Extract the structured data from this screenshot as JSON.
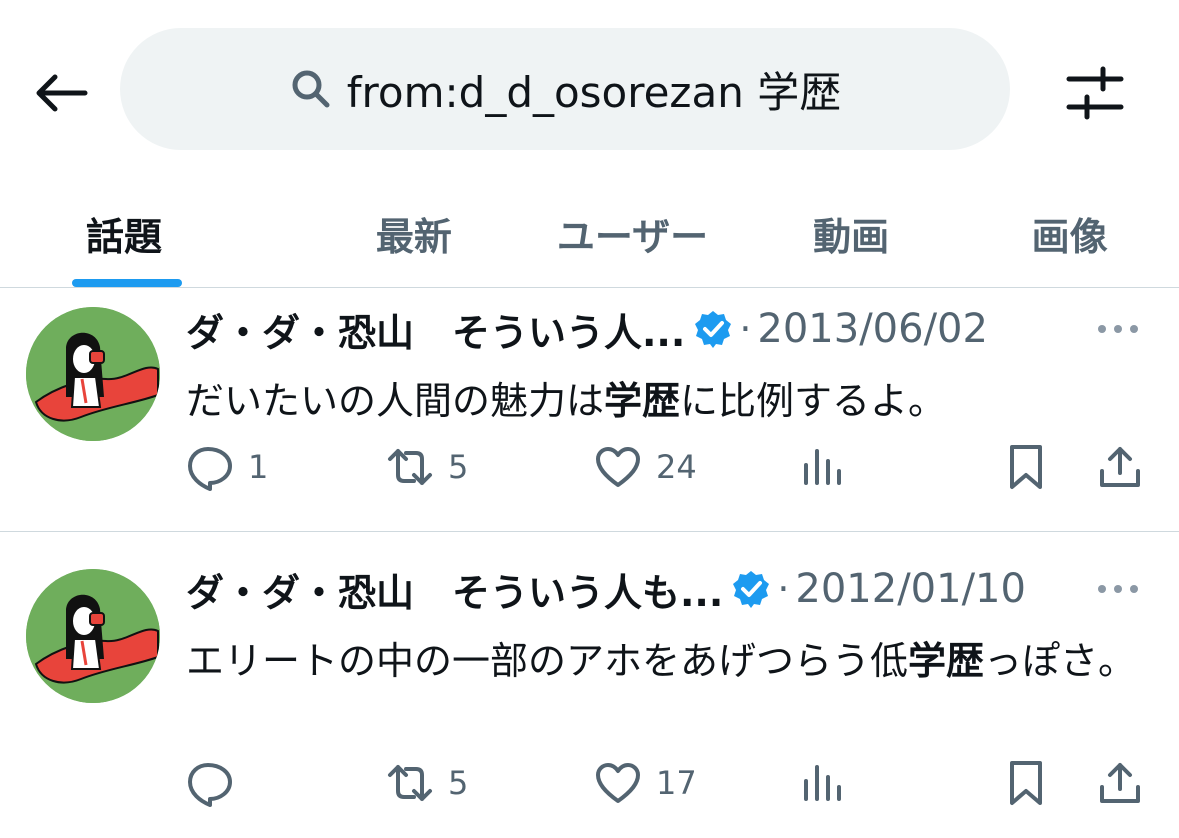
{
  "search": {
    "query_prefix": "from:d_d_osorezan ",
    "query_keyword": "学歴"
  },
  "tabs": [
    {
      "label": "話題",
      "active": true
    },
    {
      "label": "最新",
      "active": false
    },
    {
      "label": "ユーザー",
      "active": false
    },
    {
      "label": "動画",
      "active": false
    },
    {
      "label": "画像",
      "active": false
    }
  ],
  "colors": {
    "accent": "#1d9bf0",
    "text_primary": "#0f1419",
    "text_secondary": "#536471",
    "search_bg": "#eff3f4",
    "divider": "#cfd9de"
  },
  "tweets": [
    {
      "display_name": "ダ・ダ・恐山　そういう人...",
      "verified": true,
      "separator": "·",
      "date": "2013/06/02",
      "text_before": "だいたいの人間の魅力は",
      "text_highlight": "学歴",
      "text_after": "に比例するよ。",
      "replies": "1",
      "retweets": "5",
      "likes": "24"
    },
    {
      "display_name": "ダ・ダ・恐山　そういう人も...",
      "verified": true,
      "separator": "·",
      "date": "2012/01/10",
      "text_before": "エリートの中の一部のアホをあげつらう低",
      "text_highlight": "学歴",
      "text_after": "っぽさ。",
      "replies": "",
      "retweets": "5",
      "likes": "17"
    }
  ],
  "icons": {
    "back": "arrow-left-icon",
    "search": "search-icon",
    "filter": "sliders-icon",
    "verified": "verified-badge-icon",
    "more": "more-horizontal-icon",
    "reply": "reply-icon",
    "retweet": "retweet-icon",
    "like": "heart-icon",
    "views": "views-chart-icon",
    "bookmark": "bookmark-icon",
    "share": "share-icon"
  }
}
